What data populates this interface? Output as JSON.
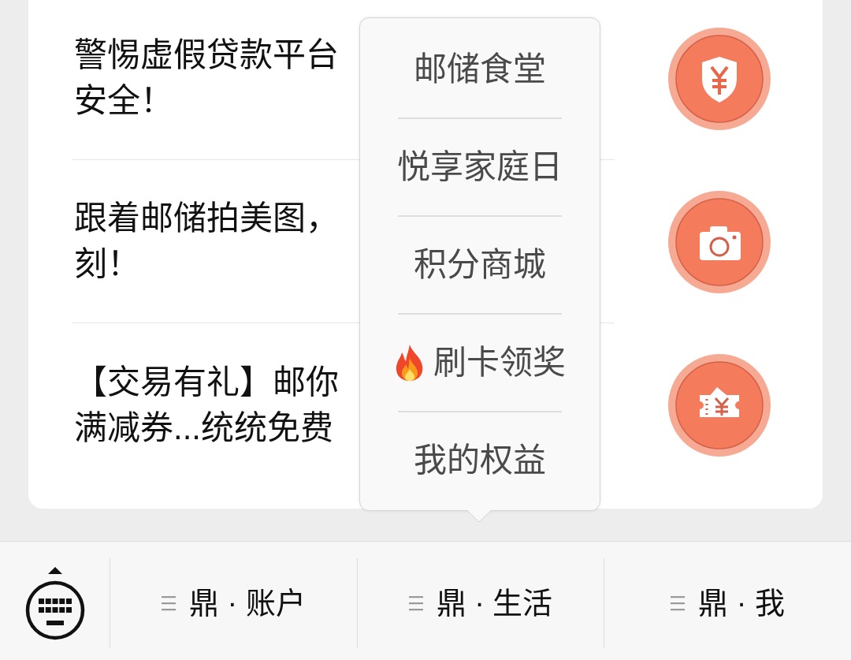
{
  "news_items": [
    {
      "kind": "shield",
      "lines": [
        "警惕虚假贷款平台",
        "安全！"
      ]
    },
    {
      "kind": "camera",
      "lines": [
        "跟着邮储拍美图，",
        "刻！"
      ]
    },
    {
      "kind": "ticket",
      "lines": [
        "【交易有礼】邮你",
        "满减券...统统免费"
      ]
    }
  ],
  "popup_menu": {
    "items": [
      {
        "label": "邮储食堂",
        "hot": false
      },
      {
        "label": "悦享家庭日",
        "hot": false
      },
      {
        "label": "积分商城",
        "hot": false
      },
      {
        "label": "刷卡领奖",
        "hot": true
      },
      {
        "label": "我的权益",
        "hot": false
      }
    ]
  },
  "bottom_bar": {
    "tabs": [
      {
        "label": "鼎 · 账户"
      },
      {
        "label": "鼎 · 生活"
      },
      {
        "label": "鼎 · 我"
      }
    ]
  }
}
